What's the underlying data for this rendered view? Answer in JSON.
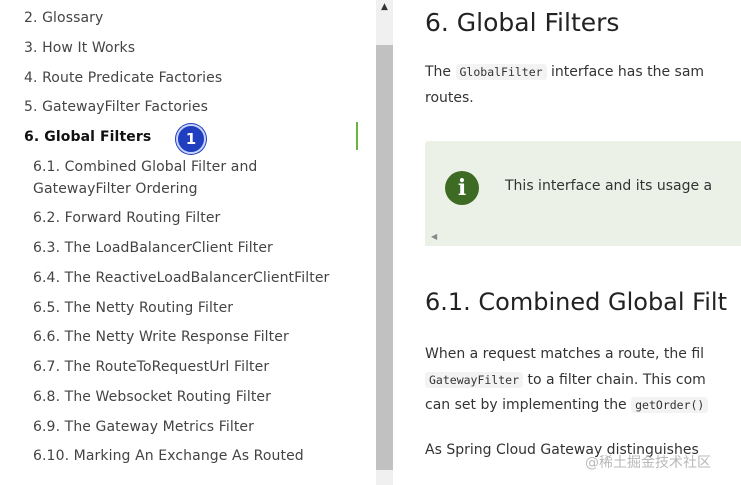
{
  "sidebar": {
    "items": [
      {
        "label": "2. Glossary"
      },
      {
        "label": "3. How It Works"
      },
      {
        "label": "4. Route Predicate Factories"
      },
      {
        "label": "5. GatewayFilter Factories"
      },
      {
        "label": "6. Global Filters"
      },
      {
        "label": "6.1. Combined Global Filter and GatewayFilter Ordering"
      },
      {
        "label": "6.2. Forward Routing Filter"
      },
      {
        "label": "6.3. The LoadBalancerClient Filter"
      },
      {
        "label": "6.4. The ReactiveLoadBalancerClientFilter"
      },
      {
        "label": "6.5. The Netty Routing Filter"
      },
      {
        "label": "6.6. The Netty Write Response Filter"
      },
      {
        "label": "6.7. The RouteToRequestUrl Filter"
      },
      {
        "label": "6.8. The Websocket Routing Filter"
      },
      {
        "label": "6.9. The Gateway Metrics Filter"
      },
      {
        "label": "6.10. Marking An Exchange As Routed"
      }
    ],
    "badge": "1"
  },
  "main": {
    "title": "6. Global Filters",
    "intro_pre": "The ",
    "intro_code": "GlobalFilter",
    "intro_post": " interface has the sam",
    "intro_line2": "routes.",
    "admonition_text": "This interface and its usage a",
    "section_title": "6.1. Combined Global Filt",
    "p1_line1": "When a request matches a route, the fil",
    "p1_code1": "GatewayFilter",
    "p1_line2_post": " to a filter chain. This com",
    "p1_line3_pre": "can set by implementing the ",
    "p1_code2": "getOrder()",
    "p2_line1": "As Spring Cloud Gateway distinguishes"
  },
  "watermark": "@稀土掘金技术社区",
  "colors": {
    "accent_green": "#6db33f",
    "info_icon": "#3d6b23",
    "admonition_bg": "#ebf1e7",
    "badge_blue": "#1f3fbf"
  }
}
